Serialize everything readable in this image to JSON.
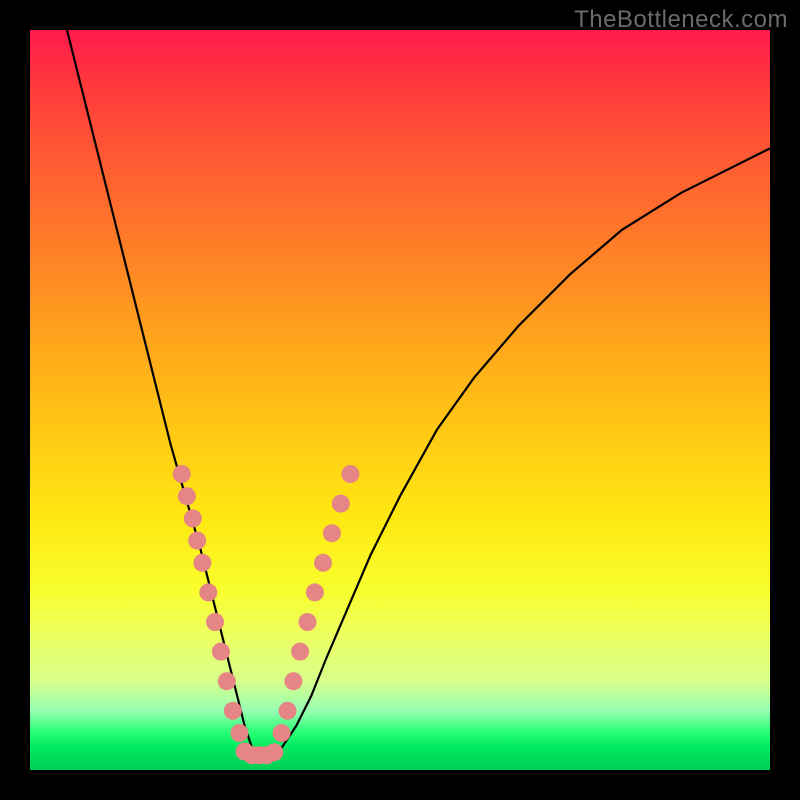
{
  "watermark": "TheBottleneck.com",
  "chart_data": {
    "type": "line",
    "title": "",
    "xlabel": "",
    "ylabel": "",
    "xlim": [
      0,
      100
    ],
    "ylim": [
      0,
      100
    ],
    "series": [
      {
        "name": "bottleneck-curve",
        "x": [
          5,
          7,
          9,
          11,
          13,
          15,
          17,
          19,
          21,
          23,
          25,
          26,
          27,
          28,
          29,
          30,
          31,
          32,
          34,
          36,
          38,
          40,
          43,
          46,
          50,
          55,
          60,
          66,
          73,
          80,
          88,
          96,
          100
        ],
        "y": [
          100,
          92,
          84,
          76,
          68,
          60,
          52,
          44,
          37,
          30,
          22,
          18,
          14,
          10,
          6,
          3,
          2,
          2,
          3,
          6,
          10,
          15,
          22,
          29,
          37,
          46,
          53,
          60,
          67,
          73,
          78,
          82,
          84
        ]
      }
    ],
    "markers": [
      {
        "name": "left-cluster",
        "points": [
          {
            "x": 20.5,
            "y": 40
          },
          {
            "x": 21.2,
            "y": 37
          },
          {
            "x": 22.0,
            "y": 34
          },
          {
            "x": 22.6,
            "y": 31
          },
          {
            "x": 23.3,
            "y": 28
          },
          {
            "x": 24.1,
            "y": 24
          },
          {
            "x": 25.0,
            "y": 20
          },
          {
            "x": 25.8,
            "y": 16
          },
          {
            "x": 26.6,
            "y": 12
          },
          {
            "x": 27.4,
            "y": 8
          },
          {
            "x": 28.3,
            "y": 5
          }
        ]
      },
      {
        "name": "bottom-cluster",
        "points": [
          {
            "x": 29.0,
            "y": 2.5
          },
          {
            "x": 30.0,
            "y": 2.0
          },
          {
            "x": 31.0,
            "y": 2.0
          },
          {
            "x": 32.0,
            "y": 2.0
          },
          {
            "x": 33.0,
            "y": 2.4
          }
        ]
      },
      {
        "name": "right-cluster",
        "points": [
          {
            "x": 34.0,
            "y": 5
          },
          {
            "x": 34.8,
            "y": 8
          },
          {
            "x": 35.6,
            "y": 12
          },
          {
            "x": 36.5,
            "y": 16
          },
          {
            "x": 37.5,
            "y": 20
          },
          {
            "x": 38.5,
            "y": 24
          },
          {
            "x": 39.6,
            "y": 28
          },
          {
            "x": 40.8,
            "y": 32
          },
          {
            "x": 42.0,
            "y": 36
          },
          {
            "x": 43.3,
            "y": 40
          }
        ]
      }
    ]
  }
}
